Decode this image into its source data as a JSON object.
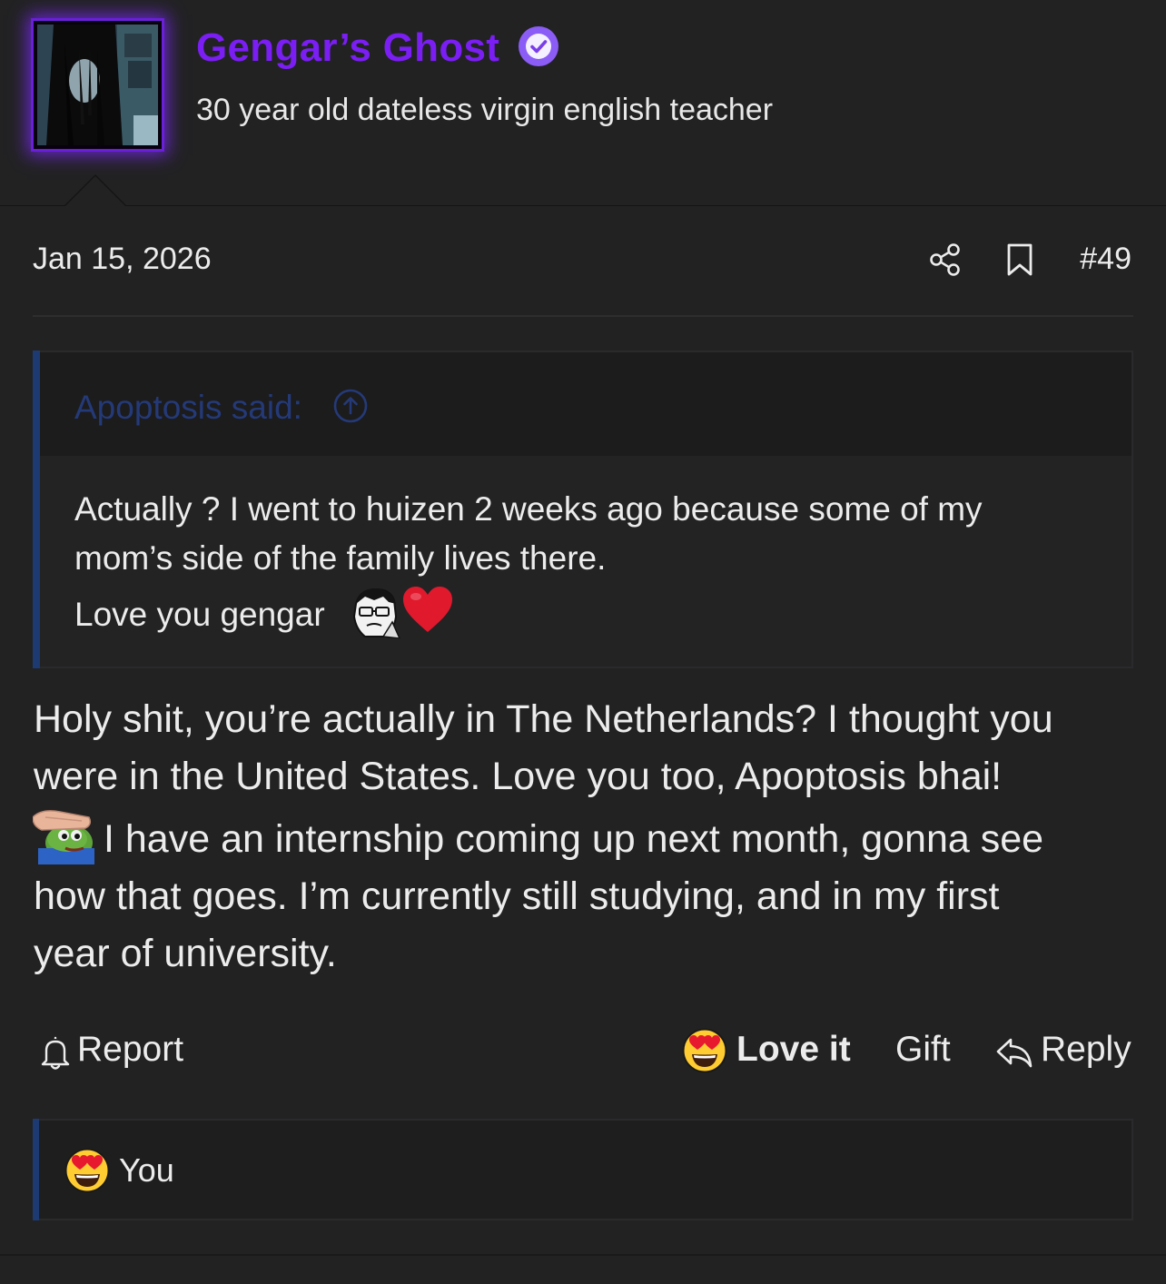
{
  "user": {
    "name": "Gengar’s Ghost",
    "title": "30 year old dateless virgin english teacher",
    "avatar_icon": "avatar-image",
    "verified_icon": "verified-check-icon",
    "name_color": "#7a1ef3",
    "verified_color": "#8b5cf6",
    "avatar_glow_color": "#7d28ff"
  },
  "post": {
    "date": "Jan 15, 2026",
    "number": "#49",
    "share_icon": "share-icon",
    "bookmark_icon": "bookmark-icon",
    "quote": {
      "author_label": "Apoptosis said:",
      "jump_icon": "arrow-up-circle-icon",
      "lines": [
        "Actually ? I went to huizen 2 weeks ago because some of my",
        "mom’s side of the family lives there.",
        "Love you gengar"
      ],
      "bar_color": "#1d3a73"
    },
    "body_lines": [
      "Holy shit, you’re actually in The Netherlands? I thought you",
      "were in the United States. Love you too, Apoptosis bhai!",
      "I have an internship coming up next month, gonna see",
      "how that goes. I’m currently still studying, and in my first",
      "year of university."
    ]
  },
  "actions": {
    "report_label": "Report",
    "love_label": "Love it",
    "gift_label": "Gift",
    "reply_label": "Reply",
    "report_icon": "bell-icon",
    "love_icon": "heart-eyes-emoji-icon",
    "reply_icon": "reply-arrow-icon"
  },
  "reactions": {
    "emoji": "heart-eyes-emoji-icon",
    "users": "You"
  }
}
